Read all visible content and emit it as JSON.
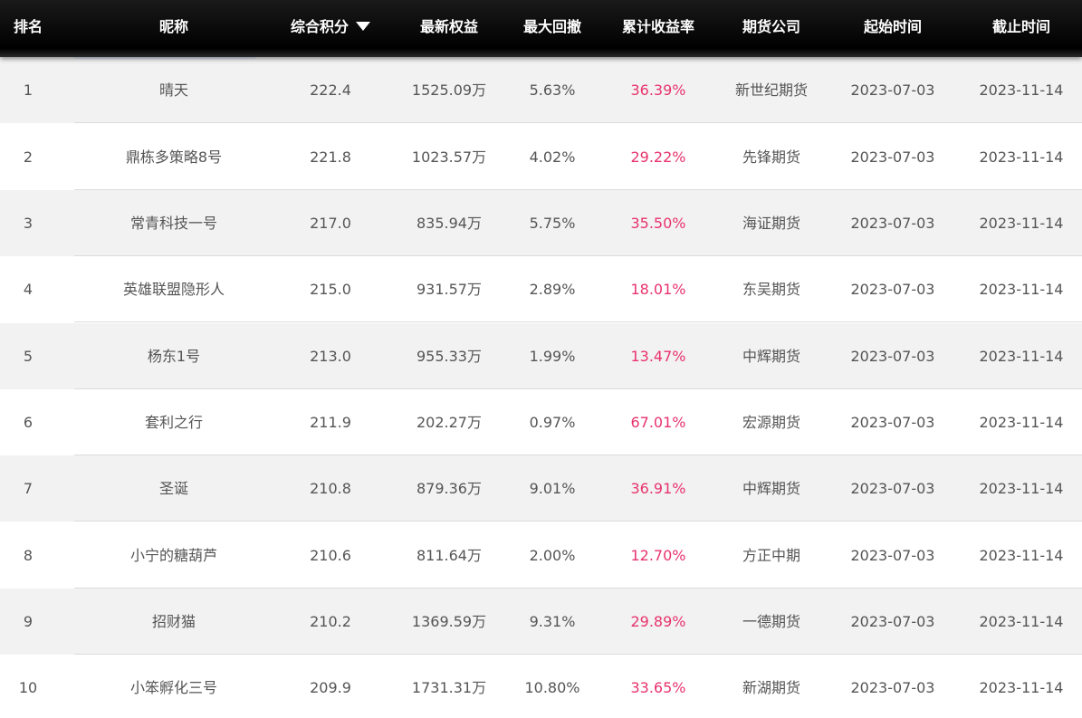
{
  "headers": {
    "rank": "排名",
    "nickname": "昵称",
    "score": "综合积分",
    "equity": "最新权益",
    "drawdown": "最大回撤",
    "return_rate": "累计收益率",
    "company": "期货公司",
    "start": "起始时间",
    "end": "截止时间"
  },
  "sort": {
    "column": "score",
    "direction": "desc",
    "icon": "caret-down-icon"
  },
  "colors": {
    "header_bg": "#000000",
    "header_text": "#ffffff",
    "rate_text": "#e8336d",
    "body_text": "#555555",
    "stripe": "#f2f2f2"
  },
  "rows": [
    {
      "rank": "1",
      "nickname": "晴天",
      "score": "222.4",
      "equity": "1525.09万",
      "drawdown": "5.63%",
      "return_rate": "36.39%",
      "company": "新世纪期货",
      "start": "2023-07-03",
      "end": "2023-11-14"
    },
    {
      "rank": "2",
      "nickname": "鼎栋多策略8号",
      "score": "221.8",
      "equity": "1023.57万",
      "drawdown": "4.02%",
      "return_rate": "29.22%",
      "company": "先锋期货",
      "start": "2023-07-03",
      "end": "2023-11-14"
    },
    {
      "rank": "3",
      "nickname": "常青科技一号",
      "score": "217.0",
      "equity": "835.94万",
      "drawdown": "5.75%",
      "return_rate": "35.50%",
      "company": "海证期货",
      "start": "2023-07-03",
      "end": "2023-11-14"
    },
    {
      "rank": "4",
      "nickname": "英雄联盟隐形人",
      "score": "215.0",
      "equity": "931.57万",
      "drawdown": "2.89%",
      "return_rate": "18.01%",
      "company": "东吴期货",
      "start": "2023-07-03",
      "end": "2023-11-14"
    },
    {
      "rank": "5",
      "nickname": "杨东1号",
      "score": "213.0",
      "equity": "955.33万",
      "drawdown": "1.99%",
      "return_rate": "13.47%",
      "company": "中辉期货",
      "start": "2023-07-03",
      "end": "2023-11-14"
    },
    {
      "rank": "6",
      "nickname": "套利之行",
      "score": "211.9",
      "equity": "202.27万",
      "drawdown": "0.97%",
      "return_rate": "67.01%",
      "company": "宏源期货",
      "start": "2023-07-03",
      "end": "2023-11-14"
    },
    {
      "rank": "7",
      "nickname": "圣诞",
      "score": "210.8",
      "equity": "879.36万",
      "drawdown": "9.01%",
      "return_rate": "36.91%",
      "company": "中辉期货",
      "start": "2023-07-03",
      "end": "2023-11-14"
    },
    {
      "rank": "8",
      "nickname": "小宁的糖葫芦",
      "score": "210.6",
      "equity": "811.64万",
      "drawdown": "2.00%",
      "return_rate": "12.70%",
      "company": "方正中期",
      "start": "2023-07-03",
      "end": "2023-11-14"
    },
    {
      "rank": "9",
      "nickname": "招财猫",
      "score": "210.2",
      "equity": "1369.59万",
      "drawdown": "9.31%",
      "return_rate": "29.89%",
      "company": "一德期货",
      "start": "2023-07-03",
      "end": "2023-11-14"
    },
    {
      "rank": "10",
      "nickname": "小笨孵化三号",
      "score": "209.9",
      "equity": "1731.31万",
      "drawdown": "10.80%",
      "return_rate": "33.65%",
      "company": "新湖期货",
      "start": "2023-07-03",
      "end": "2023-11-14"
    }
  ]
}
